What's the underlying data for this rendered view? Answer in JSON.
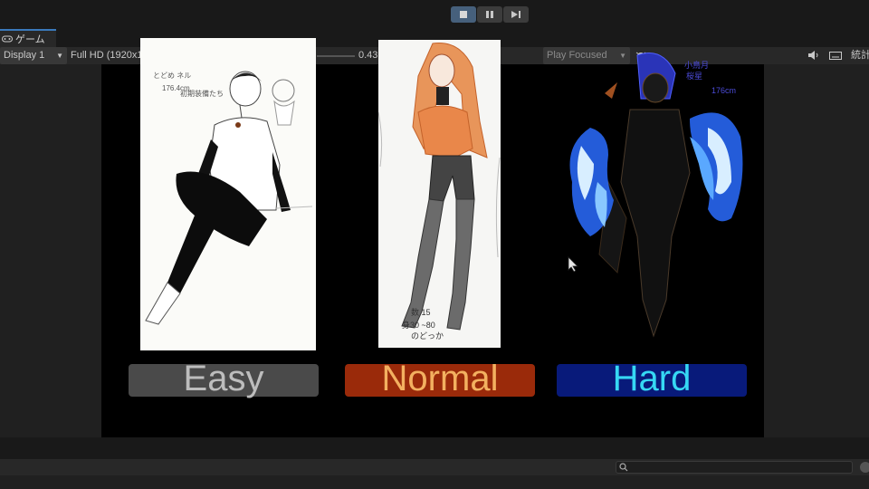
{
  "toolbar": {
    "play": "play",
    "pause": "pause",
    "step": "step"
  },
  "tab": {
    "label": "ゲーム"
  },
  "controls": {
    "display": "Display 1",
    "resolution": "Full HD (1920x1",
    "scale_value": "0.43",
    "play_mode": "Play Focused",
    "stats": "統計"
  },
  "panels": {
    "easy": {
      "text1": "とどめ ネル",
      "text2": "176.4cm",
      "text3": "初期装備たち"
    },
    "normal": {
      "text1": "数 15",
      "text2": "身30 ~80",
      "text3": "のどっか"
    },
    "hard": {
      "text1": "小鳥月",
      "text2": "桜星",
      "text3": "176cm"
    }
  },
  "difficulty": {
    "easy": "Easy",
    "normal": "Normal",
    "hard": "Hard"
  },
  "colors": {
    "easy_bg": "#4a4a4a",
    "easy_text": "#bdbdbd",
    "normal_bg": "#9a2a0a",
    "normal_text": "#f3b060",
    "hard_bg": "#081a7a",
    "hard_text": "#36d8f4",
    "accent": "#3a79bb"
  }
}
